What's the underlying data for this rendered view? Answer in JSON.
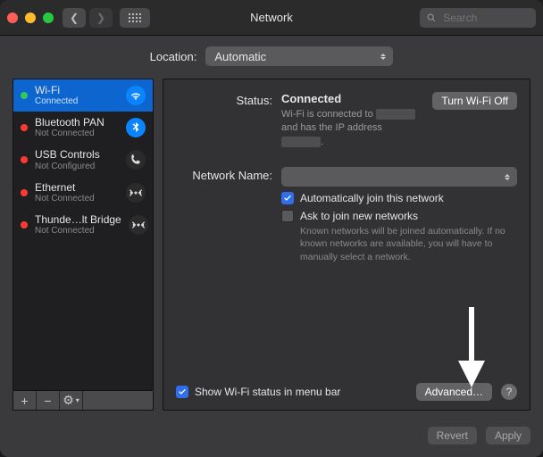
{
  "title": "Network",
  "search": {
    "placeholder": "Search"
  },
  "location": {
    "label": "Location:",
    "value": "Automatic"
  },
  "sidebar": {
    "items": [
      {
        "name": "Wi-Fi",
        "status": "Connected",
        "dot": "g",
        "icon": "wifi",
        "iconBg": "#0a84ff"
      },
      {
        "name": "Bluetooth PAN",
        "status": "Not Connected",
        "dot": "r",
        "icon": "bluetooth",
        "iconBg": "#0a84ff"
      },
      {
        "name": "USB Controls",
        "status": "Not Configured",
        "dot": "r",
        "icon": "phone",
        "iconBg": "#2b2b2c"
      },
      {
        "name": "Ethernet",
        "status": "Not Connected",
        "dot": "r",
        "icon": "ethernet",
        "iconBg": "#2b2b2c"
      },
      {
        "name": "Thunde…lt Bridge",
        "status": "Not Connected",
        "dot": "r",
        "icon": "ethernet",
        "iconBg": "#2b2b2c"
      }
    ],
    "tools": {
      "add": "+",
      "remove": "−",
      "gear": "⚙︎"
    }
  },
  "main": {
    "status_label": "Status:",
    "status_value": "Connected",
    "toggle": "Turn Wi-Fi Off",
    "desc1": "Wi-Fi is connected to ",
    "desc2": " and has the IP address ",
    "net_label": "Network Name:",
    "net_value": "",
    "chk_auto": "Automatically join this network",
    "chk_ask": "Ask to join new networks",
    "hint": "Known networks will be joined automatically. If no known networks are available, you will have to manually select a network.",
    "show_menubar": "Show Wi-Fi status in menu bar",
    "advanced": "Advanced…"
  },
  "footer": {
    "revert": "Revert",
    "apply": "Apply"
  }
}
